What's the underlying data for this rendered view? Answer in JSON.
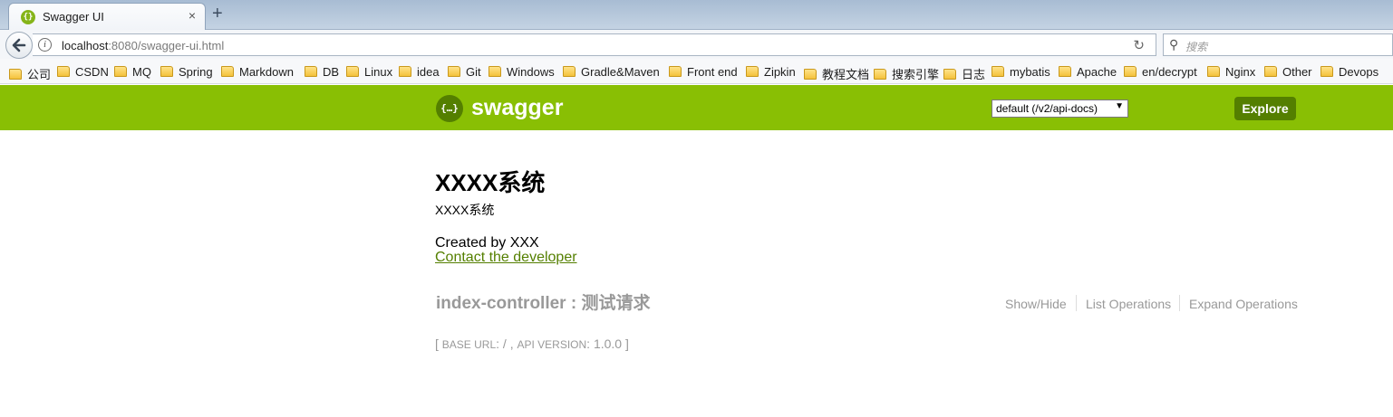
{
  "browser": {
    "tab_title": "Swagger UI",
    "tab_close": "×",
    "new_tab": "+",
    "url_host": "localhost",
    "url_rest": ":8080/swagger-ui.html",
    "search_placeholder": "搜索",
    "bookmarks": [
      "公司",
      "CSDN",
      "MQ",
      "Spring",
      "Markdown",
      "DB",
      "Linux",
      "idea",
      "Git",
      "Windows",
      "Gradle&Maven",
      "Front end",
      "Zipkin",
      "教程文档",
      "搜索引擎",
      "日志",
      "mybatis",
      "Apache",
      "en/decrypt",
      "Nginx",
      "Other",
      "Devops"
    ]
  },
  "header": {
    "logo_glyph": "{…}",
    "brand": "swagger",
    "spec_select": "default (/v2/api-docs)",
    "explore_label": "Explore",
    "brand_color": "#89bf04",
    "accent_color": "#547f00"
  },
  "info": {
    "title": "XXXX系统",
    "description": "XXXX系统",
    "created_by": "Created by XXX",
    "contact_link": "Contact the developer"
  },
  "resource": {
    "name": "index-controller : 测试请求",
    "show_hide": "Show/Hide",
    "list_operations": "List Operations",
    "expand_operations": "Expand Operations"
  },
  "footer_info": {
    "open_bracket": "[",
    "base_url_label": "BASE URL",
    "base_url_value": ": / ,",
    "api_version_label": "API VERSION",
    "api_version_value": ": 1.0.0 ]"
  }
}
